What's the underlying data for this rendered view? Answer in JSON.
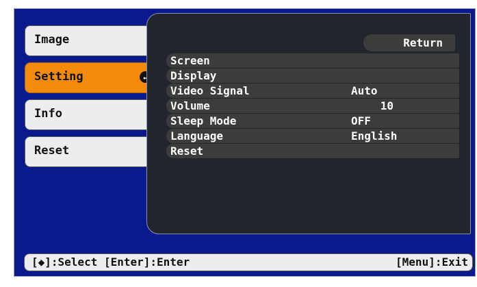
{
  "sidebar": {
    "items": [
      {
        "label": "Image"
      },
      {
        "label": "Setting",
        "active": true,
        "icon": "enter-icon"
      },
      {
        "label": "Info"
      },
      {
        "label": "Reset"
      }
    ]
  },
  "panel": {
    "return_label": "Return",
    "rows": [
      {
        "label": "Screen",
        "value": ""
      },
      {
        "label": "Display",
        "value": ""
      },
      {
        "label": "Video Signal",
        "value": "Auto"
      },
      {
        "label": "Volume",
        "value": "10"
      },
      {
        "label": "Sleep Mode",
        "value": "OFF"
      },
      {
        "label": "Language",
        "value": "English"
      },
      {
        "label": "Reset",
        "value": ""
      }
    ]
  },
  "footer": {
    "left_text": "[◆]:Select [Enter]:Enter",
    "right_text": "[Menu]:Exit"
  },
  "colors": {
    "background": "#0a1a8c",
    "active_tab": "#f28a0c",
    "panel": "#20262c",
    "row": "#3c3c3c"
  }
}
